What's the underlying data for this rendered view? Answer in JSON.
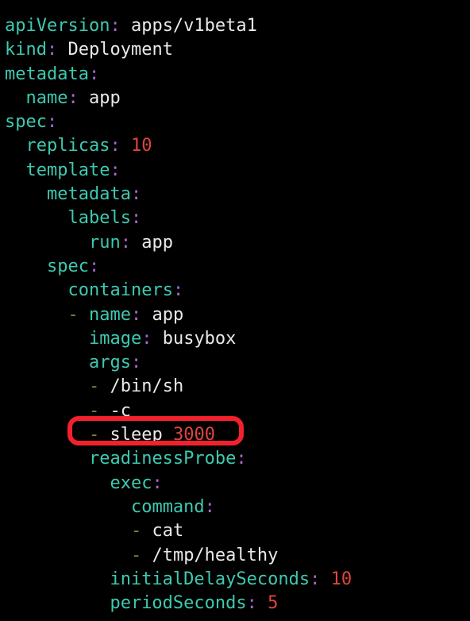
{
  "editor": {
    "language": "yaml",
    "background_color": "#000000",
    "colors": {
      "key": "#3dc9b0",
      "colon": "#a868d0",
      "value": "#e9e9e9",
      "number": "#e0453a",
      "dash": "#8a7a40",
      "annotation": "#f2212c"
    },
    "lines": [
      {
        "indent": 0,
        "key": "apiVersion",
        "value": "apps/v1beta1",
        "value_kind": "string"
      },
      {
        "indent": 0,
        "key": "kind",
        "value": "Deployment",
        "value_kind": "string"
      },
      {
        "indent": 0,
        "key": "metadata",
        "value": "",
        "value_kind": "none"
      },
      {
        "indent": 2,
        "key": "name",
        "value": "app",
        "value_kind": "string"
      },
      {
        "indent": 0,
        "key": "spec",
        "value": "",
        "value_kind": "none"
      },
      {
        "indent": 2,
        "key": "replicas",
        "value": "10",
        "value_kind": "number"
      },
      {
        "indent": 2,
        "key": "template",
        "value": "",
        "value_kind": "none"
      },
      {
        "indent": 4,
        "key": "metadata",
        "value": "",
        "value_kind": "none"
      },
      {
        "indent": 6,
        "key": "labels",
        "value": "",
        "value_kind": "none"
      },
      {
        "indent": 8,
        "key": "run",
        "value": "app",
        "value_kind": "string"
      },
      {
        "indent": 4,
        "key": "spec",
        "value": "",
        "value_kind": "none"
      },
      {
        "indent": 6,
        "key": "containers",
        "value": "",
        "value_kind": "none"
      },
      {
        "indent": 6,
        "dash": true,
        "key": "name",
        "value": "app",
        "value_kind": "string"
      },
      {
        "indent": 8,
        "key": "image",
        "value": "busybox",
        "value_kind": "string"
      },
      {
        "indent": 8,
        "key": "args",
        "value": "",
        "value_kind": "none"
      },
      {
        "indent": 8,
        "dash": true,
        "key": "",
        "value": "/bin/sh",
        "value_kind": "string"
      },
      {
        "indent": 8,
        "dash": true,
        "key": "",
        "value": "-c",
        "value_kind": "string"
      },
      {
        "indent": 8,
        "dash": true,
        "key": "",
        "value": "sleep 3000",
        "value_kind": "mixed",
        "highlighted": true
      },
      {
        "indent": 8,
        "key": "readinessProbe",
        "value": "",
        "value_kind": "none"
      },
      {
        "indent": 10,
        "key": "exec",
        "value": "",
        "value_kind": "none"
      },
      {
        "indent": 12,
        "key": "command",
        "value": "",
        "value_kind": "none"
      },
      {
        "indent": 12,
        "dash": true,
        "key": "",
        "value": "cat",
        "value_kind": "string"
      },
      {
        "indent": 12,
        "dash": true,
        "key": "",
        "value": "/tmp/healthy",
        "value_kind": "string"
      },
      {
        "indent": 10,
        "key": "initialDelaySeconds",
        "value": "10",
        "value_kind": "number"
      },
      {
        "indent": 10,
        "key": "periodSeconds",
        "value": "5",
        "value_kind": "number"
      }
    ]
  },
  "annotation": {
    "shape": "rounded-rectangle",
    "color": "#f2212c",
    "target_text": "- sleep 3000"
  }
}
